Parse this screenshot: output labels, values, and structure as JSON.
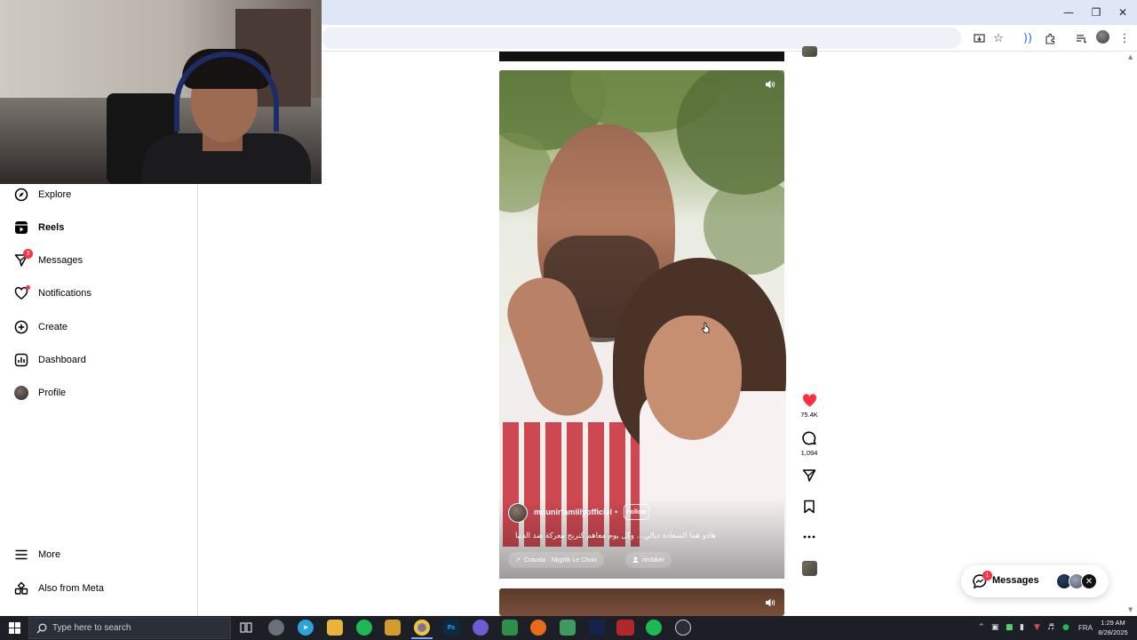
{
  "sidebar": {
    "items": [
      {
        "label": "Explore",
        "icon": "compass-icon"
      },
      {
        "label": "Reels",
        "icon": "reels-icon",
        "active": true
      },
      {
        "label": "Messages",
        "icon": "messages-icon",
        "badge": "3"
      },
      {
        "label": "Notifications",
        "icon": "heart-icon",
        "dot": true
      },
      {
        "label": "Create",
        "icon": "plus-square-icon"
      },
      {
        "label": "Dashboard",
        "icon": "dashboard-icon"
      },
      {
        "label": "Profile",
        "icon": "avatar"
      }
    ],
    "bottom": [
      {
        "label": "More",
        "icon": "hamburger-icon"
      },
      {
        "label": "Also from Meta",
        "icon": "meta-icon"
      }
    ]
  },
  "reel": {
    "author": "mounirfamillyofficiel",
    "follow": "Follow",
    "caption": "هادو هما السعادة ديالي... وكل يوم معاهم كنربح معركة ضد الدنيا",
    "audio": "Cravata · Nbghik Le Choix",
    "tagged": "rimbiker",
    "likes": "75.4K",
    "comments": "1,094"
  },
  "messages_pill": {
    "label": "Messages",
    "badge": "1"
  },
  "taskbar": {
    "search_placeholder": "Type here to search",
    "lang": "FRA",
    "time": "1:29 AM",
    "date": "8/28/2025"
  },
  "colors": {
    "accent_like": "#ff3040",
    "taskbar_bg": "#1c1f26",
    "titlebar_bg": "#dfe7f7"
  }
}
